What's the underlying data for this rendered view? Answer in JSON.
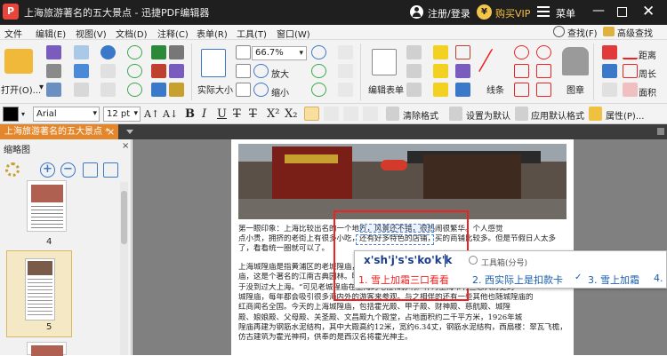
{
  "window": {
    "title": "上海旅游著名的五大景点 - 迅捷PDF编辑器",
    "app_icon_letter": "P",
    "login_label": "注册/登录",
    "vip_label": "购买VIP",
    "vip_icon_char": "¥",
    "menu_label": "菜单",
    "minimize_char": "—",
    "close_char": "✕"
  },
  "menubar": {
    "items": [
      "文件",
      "编辑(E)",
      "视图(V)",
      "文档(D)",
      "注释(C)",
      "表单(R)",
      "工具(T)",
      "窗口(W)"
    ],
    "find_label": "查找(F)",
    "advanced_find_label": "高级查找"
  },
  "ribbon": {
    "open_label": "打开(O)...",
    "open_arrow": "▾",
    "actual_size_label": "实际大小",
    "zoom_value": "66.7%",
    "zoom_in_label": "放大",
    "zoom_out_label": "缩小",
    "edit_form_label": "编辑表单",
    "line_label": "线条",
    "stamp_label": "图章",
    "distance_label": "距离",
    "perimeter_label": "周长",
    "area_label": "面积"
  },
  "format_bar": {
    "font_family": "Arial",
    "font_size": "12 pt",
    "clear_format_label": "清除格式",
    "set_default_label": "设置为默认",
    "apply_default_label": "应用默认格式",
    "properties_label": "属性(P)..."
  },
  "tab": {
    "document_name": "上海旅游著名的五大景点 *",
    "close_char": "×"
  },
  "sidebar": {
    "title": "缩略图",
    "close_char": "×",
    "page_labels": [
      "4",
      "5"
    ]
  },
  "document": {
    "lines": [
      "第一眼印象：上海比较出名的一个地方，风景还不错，很热闹很繁华。个人感觉",
      "点小贵，拥挤的老街上有很多小吃，还有好多特色的店铺，买的商铺比较多。但是节假日人太多",
      "了，看看统一圈就可以了。",
      "上海城隍庙是指黄浦区的老城隍庙，位于上海市黄浦区方浜中路，是上海道教的主要",
      "庙，这是个著名的江南古典园林。明代宣统间建成，明永乐年间，知县张守约将方浜路上的金山",
      "于没到过大上海。“可见老城隍庙在上海的地位和影响。作为上海市有些悠久历史的",
      "城隍庙，每年都会吸引很多海内外的游客来参观。与之相伴的还有一些其他也随城隍庙的",
      "红商闻名全国。今天的上海城隍庙，包括霍光殿、甲子殿、财神殿、慈航殿、城隍",
      "殿、娘娘殿、父母殿、关圣殿、文昌殿九个殿堂，占地面积约二千平方米，1926年城",
      "隍庙再建为钢筋水泥结构，其中大殿高约12米，宽约6.34丈，钢筋水泥结构，西扇楼：翠瓦飞檐，",
      "仿古建筑为霍光神祠，供奉的是西汉名将霍光神主。"
    ]
  },
  "ime": {
    "composition": "x'sh'j's's'ko'k'k",
    "toolbox_label": "工具箱(分号)",
    "candidates": [
      "1. 雪上加霜三口看看",
      "2. 西实际上是扣款卡",
      "3. 雪上加霜",
      "4."
    ],
    "check_char": "✓"
  },
  "colors": {
    "titlebar": "#1f1f1f",
    "tab_active": "#e4872c",
    "selection_outline": "#ee2222",
    "vip_gold": "#f5c242",
    "ime_candidate_selected": "#ee2222",
    "ime_candidate": "#1a5eaa"
  },
  "icons": [
    "user-icon",
    "vip-icon",
    "menu-icon",
    "folder-open-icon",
    "save-icon",
    "print-icon",
    "undo-icon",
    "redo-icon",
    "actual-size-icon",
    "zoom-in-icon",
    "zoom-out-icon",
    "text-tool-icon",
    "line-icon",
    "stamp-icon",
    "ruler-icon",
    "search-icon",
    "bold-icon",
    "italic-icon",
    "underline-icon",
    "strikethrough-icon",
    "superscript-icon",
    "subscript-icon",
    "align-left-icon",
    "align-center-icon",
    "align-right-icon",
    "justify-icon",
    "clear-format-icon",
    "properties-icon",
    "settings-icon",
    "zoom-in-circle-icon",
    "zoom-out-circle-icon",
    "fit-icon"
  ]
}
